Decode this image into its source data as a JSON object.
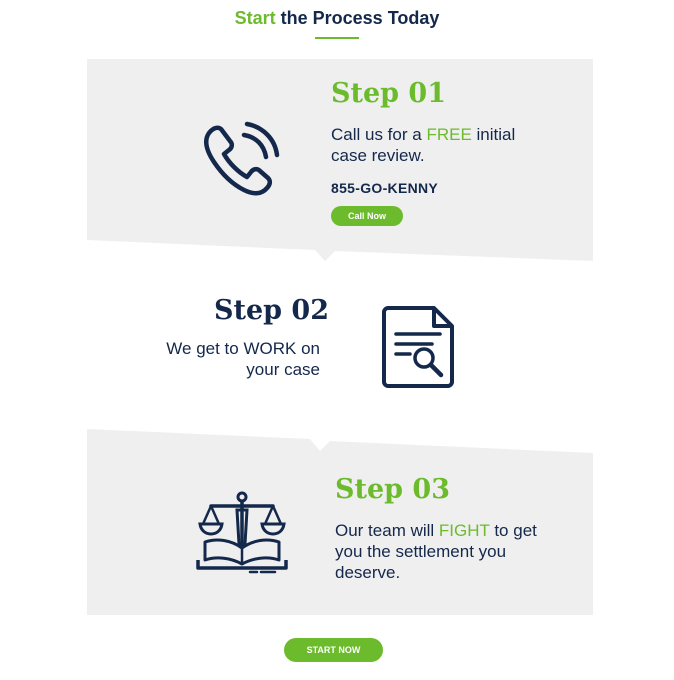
{
  "heading": {
    "accent": "Start",
    "rest": "the Process Today"
  },
  "steps": [
    {
      "title": "Step 01",
      "desc_before": "Call us for a ",
      "desc_highlight": "FREE",
      "desc_after": " initial case review.",
      "phone": "855-GO-KENNY",
      "button": "Call Now",
      "icon": "phone-icon"
    },
    {
      "title": "Step 02",
      "desc_before": "We get to ",
      "desc_highlight": "WORK",
      "desc_after": " on your case",
      "icon": "document-search-icon"
    },
    {
      "title": "Step 03",
      "desc_before": "Our team will ",
      "desc_highlight": "FIGHT",
      "desc_after": " to get you the settlement you deserve.",
      "icon": "scales-of-justice-icon"
    }
  ],
  "cta": {
    "label": "START NOW"
  },
  "colors": {
    "accent": "#6cbb2c",
    "navy": "#14284b",
    "panel": "#efefef"
  }
}
